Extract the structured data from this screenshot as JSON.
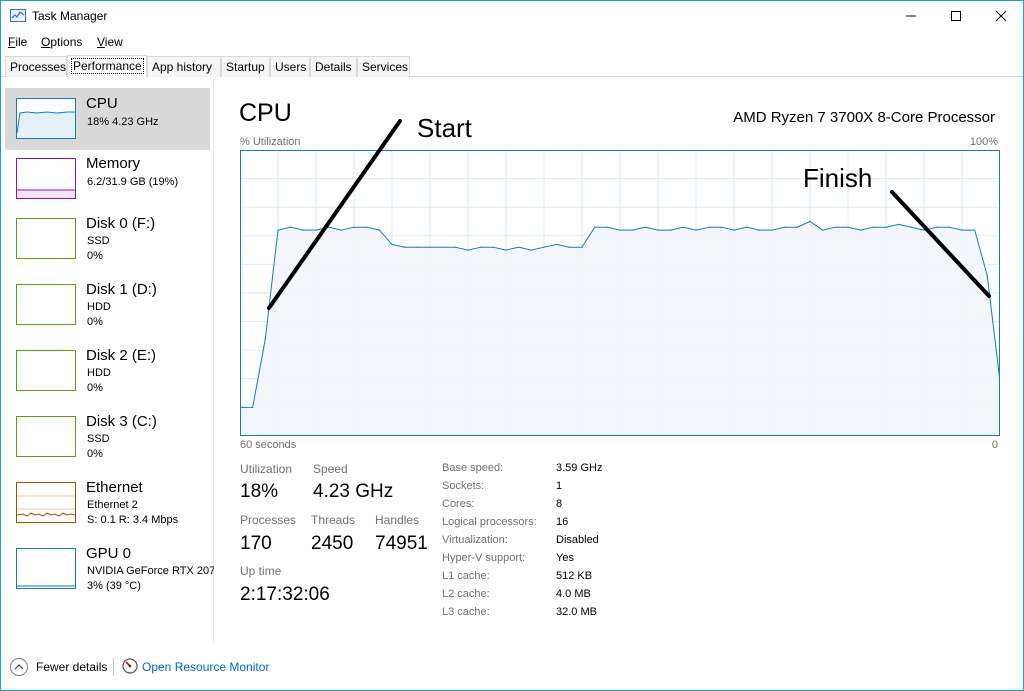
{
  "window": {
    "title": "Task Manager"
  },
  "menu": [
    {
      "label": "File",
      "accel": "F"
    },
    {
      "label": "Options",
      "accel": "O"
    },
    {
      "label": "View",
      "accel": "V"
    }
  ],
  "tabs": [
    "Processes",
    "Performance",
    "App history",
    "Startup",
    "Users",
    "Details",
    "Services"
  ],
  "active_tab": "Performance",
  "sidebar": [
    {
      "title": "CPU",
      "lines": [
        "18% 4.23 GHz"
      ],
      "color": "#117dbb",
      "active": true
    },
    {
      "title": "Memory",
      "lines": [
        "6.2/31.9 GB (19%)"
      ],
      "color": "#8b12ae"
    },
    {
      "title": "Disk 0 (F:)",
      "lines": [
        "SSD",
        "0%"
      ],
      "color": "#4da60c"
    },
    {
      "title": "Disk 1 (D:)",
      "lines": [
        "HDD",
        "0%"
      ],
      "color": "#4da60c"
    },
    {
      "title": "Disk 2 (E:)",
      "lines": [
        "HDD",
        "0%"
      ],
      "color": "#4da60c"
    },
    {
      "title": "Disk 3 (C:)",
      "lines": [
        "SSD",
        "0%"
      ],
      "color": "#4da60c"
    },
    {
      "title": "Ethernet",
      "lines": [
        "Ethernet 2",
        "S: 0.1  R: 3.4 Mbps"
      ],
      "color": "#a74f01"
    },
    {
      "title": "GPU 0",
      "lines": [
        "NVIDIA GeForce RTX 207",
        "3% (39 °C)"
      ],
      "color": "#117dbb"
    }
  ],
  "main": {
    "title": "CPU",
    "processor": "AMD Ryzen 7 3700X 8-Core Processor",
    "y_label": "% Utilization",
    "y_max_label": "100%",
    "x_left_label": "60 seconds",
    "x_right_label": "0"
  },
  "stats": {
    "utilization_label": "Utilization",
    "utilization": "18%",
    "speed_label": "Speed",
    "speed": "4.23 GHz",
    "processes_label": "Processes",
    "processes": "170",
    "threads_label": "Threads",
    "threads": "2450",
    "handles_label": "Handles",
    "handles": "74951",
    "uptime_label": "Up time",
    "uptime": "2:17:32:06"
  },
  "specs": [
    {
      "label": "Base speed:",
      "value": "3.59 GHz"
    },
    {
      "label": "Sockets:",
      "value": "1"
    },
    {
      "label": "Cores:",
      "value": "8"
    },
    {
      "label": "Logical processors:",
      "value": "16"
    },
    {
      "label": "Virtualization:",
      "value": "Disabled"
    },
    {
      "label": "Hyper-V support:",
      "value": "Yes"
    },
    {
      "label": "L1 cache:",
      "value": "512 KB"
    },
    {
      "label": "L2 cache:",
      "value": "4.0 MB"
    },
    {
      "label": "L3 cache:",
      "value": "32.0 MB"
    }
  ],
  "annotations": {
    "start": "Start",
    "finish": "Finish"
  },
  "footer": {
    "fewer_details": "Fewer details",
    "resource_monitor": "Open Resource Monitor"
  },
  "chart_data": {
    "type": "area",
    "color": "#117dbb",
    "fill": "#f1f6fa",
    "ylim": [
      0,
      100
    ],
    "xlim": [
      60,
      0
    ],
    "x": [
      60,
      59,
      58,
      57,
      56,
      55,
      54,
      53,
      52,
      51,
      50,
      49,
      48,
      47,
      46,
      45,
      44,
      43,
      42,
      41,
      40,
      39,
      38,
      37,
      36,
      35,
      34,
      33,
      32,
      31,
      30,
      29,
      28,
      27,
      26,
      25,
      24,
      23,
      22,
      21,
      20,
      19,
      18,
      17,
      16,
      15,
      14,
      13,
      12,
      11,
      10,
      9,
      8,
      7,
      6,
      5,
      4,
      3,
      2,
      1,
      0
    ],
    "values": [
      10,
      10,
      34,
      72,
      73,
      72,
      72,
      73,
      72,
      73,
      73,
      72,
      67,
      66,
      66,
      66,
      66,
      66,
      65,
      66,
      66,
      65,
      66,
      65,
      66,
      67,
      66,
      66,
      73,
      73,
      72,
      72,
      73,
      72,
      72,
      73,
      72,
      73,
      73,
      72,
      73,
      72,
      72,
      73,
      73,
      75,
      72,
      73,
      73,
      72,
      73,
      73,
      74,
      73,
      72,
      73,
      73,
      72,
      72,
      56,
      19
    ]
  }
}
